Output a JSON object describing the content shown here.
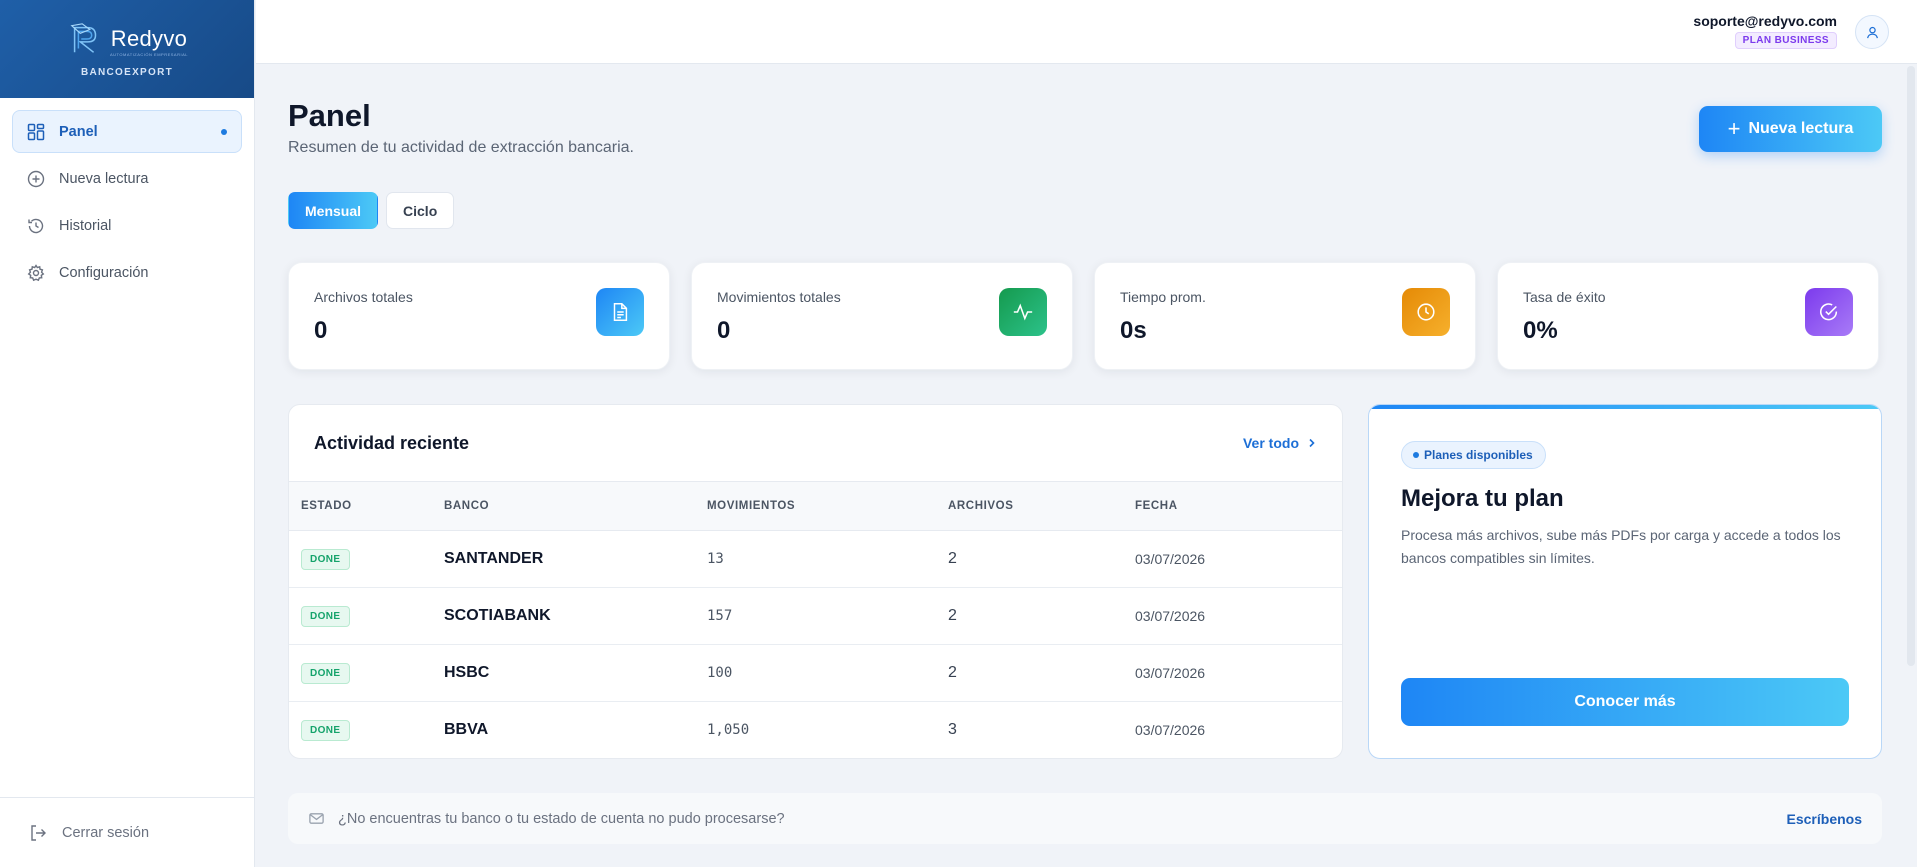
{
  "brand": {
    "name": "Redyvo",
    "tagline": "AUTOMATIZACIÓN EMPRESARIAL",
    "company": "BANCOEXPORT"
  },
  "sidebar": {
    "items": [
      {
        "label": "Panel",
        "icon": "dashboard-icon",
        "active": true
      },
      {
        "label": "Nueva lectura",
        "icon": "plus-circle-icon",
        "active": false
      },
      {
        "label": "Historial",
        "icon": "history-icon",
        "active": false
      },
      {
        "label": "Configuración",
        "icon": "gear-icon",
        "active": false
      }
    ],
    "logout_label": "Cerrar sesión"
  },
  "header": {
    "email": "soporte@redyvo.com",
    "plan": "PLAN BUSINESS"
  },
  "page": {
    "title": "Panel",
    "subtitle": "Resumen de tu actividad de extracción bancaria.",
    "new_button": "Nueva lectura",
    "toggle": {
      "options": [
        "Mensual",
        "Ciclo"
      ],
      "selected": "Mensual"
    }
  },
  "stats": [
    {
      "label": "Archivos totales",
      "value": "0",
      "icon": "file-icon",
      "color": "#2196f3"
    },
    {
      "label": "Movimientos totales",
      "value": "0",
      "icon": "activity-icon",
      "color": "#16a34a"
    },
    {
      "label": "Tiempo prom.",
      "value": "0s",
      "icon": "clock-icon",
      "color": "#f59e0b"
    },
    {
      "label": "Tasa de éxito",
      "value": "0%",
      "icon": "check-circle-icon",
      "color": "#8b5cf6"
    }
  ],
  "activity": {
    "title": "Actividad reciente",
    "view_all": "Ver todo",
    "columns": [
      "ESTADO",
      "BANCO",
      "MOVIMIENTOS",
      "ARCHIVOS",
      "FECHA"
    ],
    "rows": [
      {
        "estado": "DONE",
        "banco": "SANTANDER",
        "movimientos": "13",
        "archivos": "2",
        "fecha": "03/07/2026"
      },
      {
        "estado": "DONE",
        "banco": "SCOTIABANK",
        "movimientos": "157",
        "archivos": "2",
        "fecha": "03/07/2026"
      },
      {
        "estado": "DONE",
        "banco": "HSBC",
        "movimientos": "100",
        "archivos": "2",
        "fecha": "03/07/2026"
      },
      {
        "estado": "DONE",
        "banco": "BBVA",
        "movimientos": "1,050",
        "archivos": "3",
        "fecha": "03/07/2026"
      }
    ]
  },
  "upgrade": {
    "pill": "Planes disponibles",
    "title": "Mejora tu plan",
    "description": "Procesa más archivos, sube más PDFs por carga y accede a todos los bancos compatibles sin límites.",
    "button": "Conocer más"
  },
  "help": {
    "text": "¿No encuentras tu banco o tu estado de cuenta no pudo procesarse?",
    "link": "Escríbenos"
  },
  "colors": {
    "accent": "#1e86f5",
    "accent_light": "#4cc9f6",
    "brand_bg": "#1f5fa8",
    "success": "#15a36b"
  }
}
